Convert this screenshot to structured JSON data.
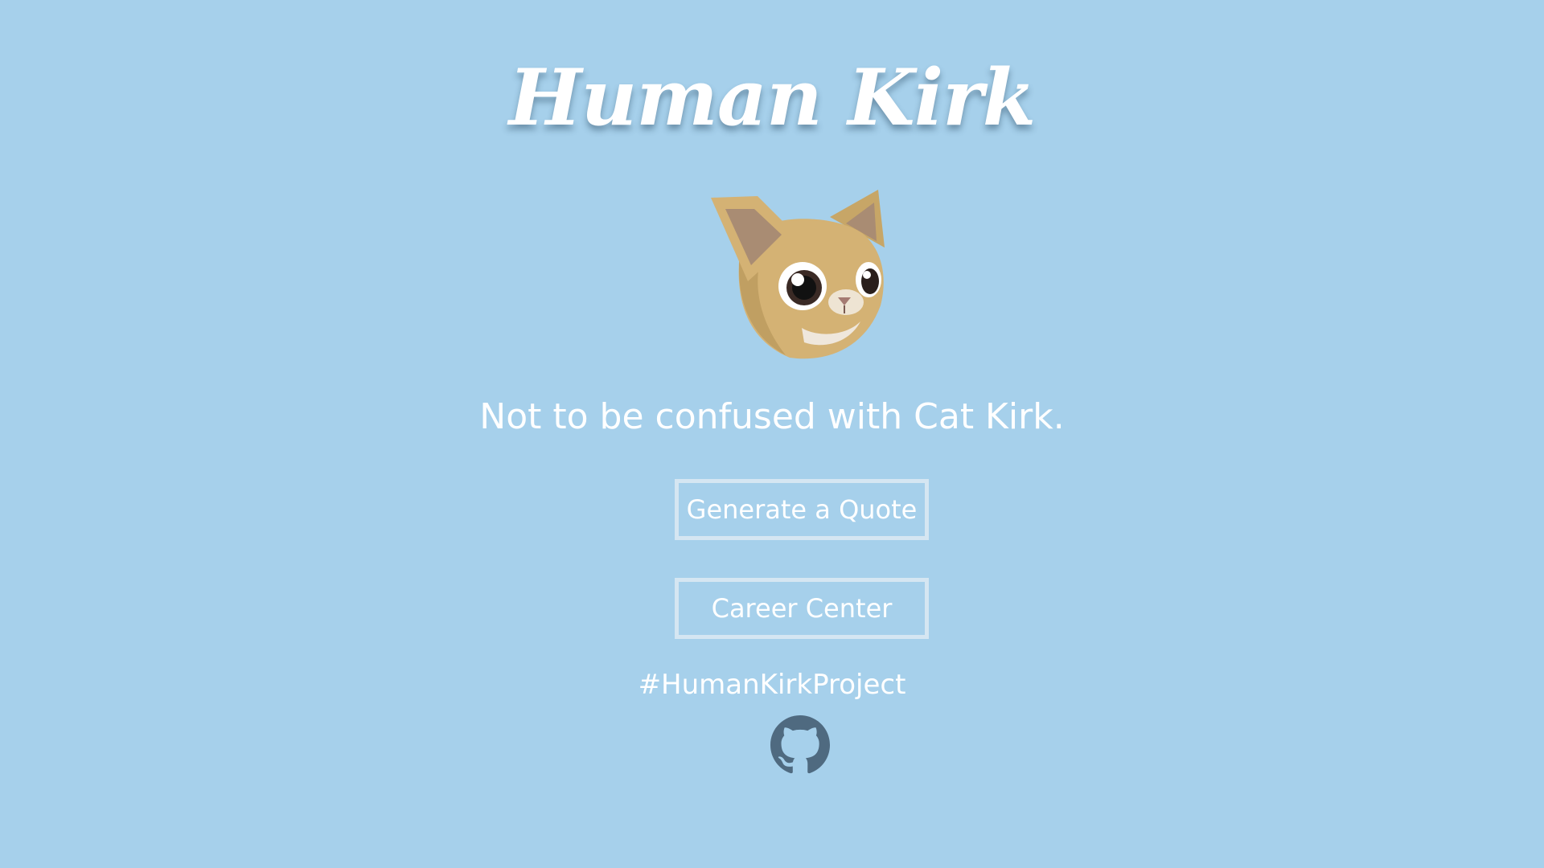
{
  "header": {
    "title": "Human Kirk"
  },
  "hero": {
    "image_icon": "cat-face-icon",
    "tagline": "Not to be confused with Cat Kirk."
  },
  "actions": {
    "generate_quote_label": "Generate a Quote",
    "career_center_label": "Career Center"
  },
  "footer": {
    "hashtag": "#HumanKirkProject",
    "link_icon": "github-icon"
  },
  "colors": {
    "background": "#a6d0eb",
    "text": "#ffffff",
    "button_border": "#d5e6f2",
    "github_icon": "#4f6a80",
    "cat_fur": "#d4b274"
  }
}
